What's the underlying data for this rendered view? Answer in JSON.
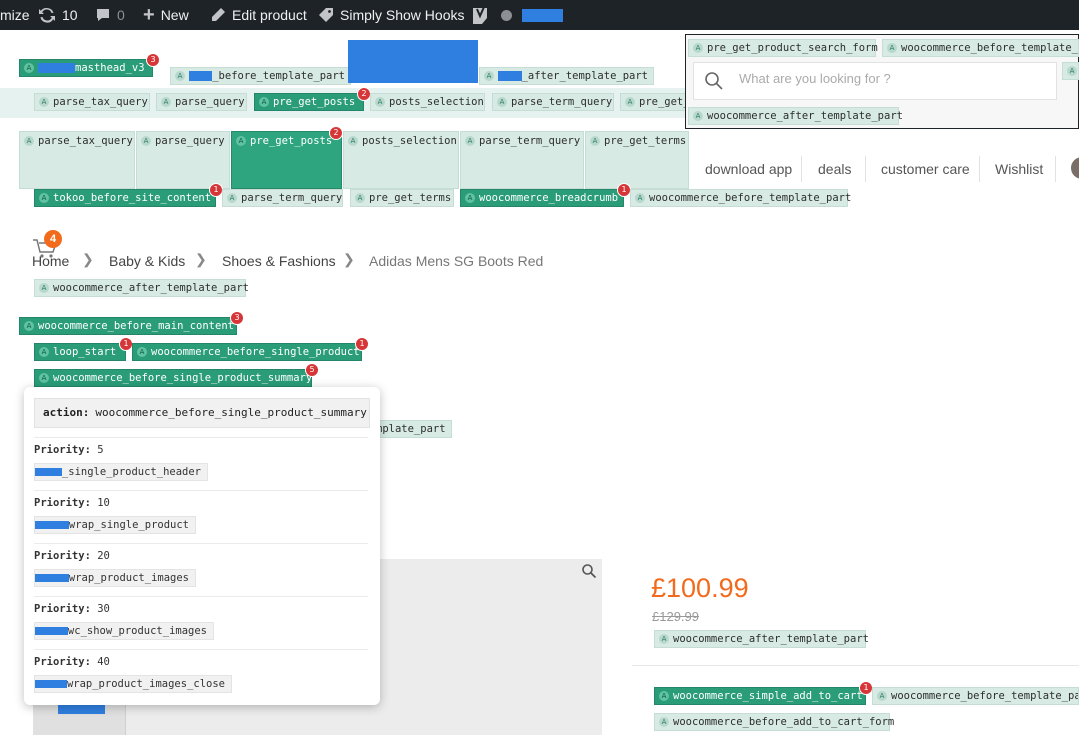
{
  "admin_bar": {
    "customize": "mize",
    "updates_count": "10",
    "comments_count": "0",
    "new": "New",
    "edit_product": "Edit product",
    "show_hooks": "Simply Show Hooks",
    "yoast_icon": "yoast-icon"
  },
  "top_hooks": {
    "masthead": "masthead_v3",
    "masthead_count": "3",
    "before_template_part": "_before_template_part",
    "after_template_part": "_after_template_part"
  },
  "row1_hooks": [
    {
      "label": "parse_tax_query"
    },
    {
      "label": "parse_query"
    },
    {
      "label": "pre_get_posts",
      "count": "2"
    },
    {
      "label": "posts_selection"
    },
    {
      "label": "parse_term_query"
    },
    {
      "label": "pre_get_terms"
    }
  ],
  "row2_hooks": [
    {
      "label": "parse_tax_query"
    },
    {
      "label": "parse_query"
    },
    {
      "label": "pre_get_posts",
      "count": "2"
    },
    {
      "label": "posts_selection"
    },
    {
      "label": "parse_term_query"
    },
    {
      "label": "pre_get_terms"
    }
  ],
  "row3_hooks": {
    "site_content": "tokoo_before_site_content",
    "site_content_count": "1",
    "parse_term_query": "parse_term_query",
    "pre_get_terms": "pre_get_terms",
    "breadcrumb": "woocommerce_breadcrumb",
    "breadcrumb_count": "1",
    "before_template_part": "woocommerce_before_template_part"
  },
  "search": {
    "hook_form": "pre_get_product_search_form",
    "hook_before_template": "woocommerce_before_template_pa",
    "placeholder": "What are you looking for ?",
    "hook_after_template": "woocommerce_after_template_part"
  },
  "nav": {
    "items": [
      "download app",
      "deals",
      "customer care",
      "Wishlist"
    ]
  },
  "cart": {
    "count": "4"
  },
  "breadcrumb": {
    "items": [
      "Home",
      "Baby & Kids",
      "Shoes & Fashions",
      "Adidas Mens SG Boots Red"
    ]
  },
  "content_hooks": {
    "after_template_part": "woocommerce_after_template_part",
    "before_main_content": "woocommerce_before_main_content",
    "before_main_content_count": "3",
    "loop_start": "loop_start",
    "loop_start_count": "1",
    "before_single_product": "woocommerce_before_single_product",
    "before_single_product_count": "1",
    "before_summary": "woocommerce_before_single_product_summary",
    "before_summary_count": "5",
    "partial_template_part": "mplate_part"
  },
  "popup": {
    "action_label": "action:",
    "action_value": "woocommerce_before_single_product_summary",
    "priority_label": "Priority:",
    "entries": [
      {
        "priority": "5",
        "fn": "_single_product_header"
      },
      {
        "priority": "10",
        "fn": "wrap_single_product"
      },
      {
        "priority": "20",
        "fn": "wrap_product_images"
      },
      {
        "priority": "30",
        "fn": "wc_show_product_images"
      },
      {
        "priority": "40",
        "fn": "wrap_product_images_close"
      }
    ]
  },
  "product": {
    "price": "£100.99",
    "old_price": "£129.99",
    "after_template_part": "woocommerce_after_template_part",
    "simple_add_to_cart": "woocommerce_simple_add_to_cart",
    "simple_add_to_cart_count": "1",
    "before_template_par": "woocommerce_before_template_par",
    "before_add_to_cart_form": "woocommerce_before_add_to_cart_form"
  },
  "colors": {
    "admin_bar": "#1d2327",
    "hook_active": "#2a9d78",
    "hook_inactive": "#d7ebe4",
    "badge": "#d63638",
    "price": "#f26b1d",
    "redaction": "#2f7fe0"
  }
}
